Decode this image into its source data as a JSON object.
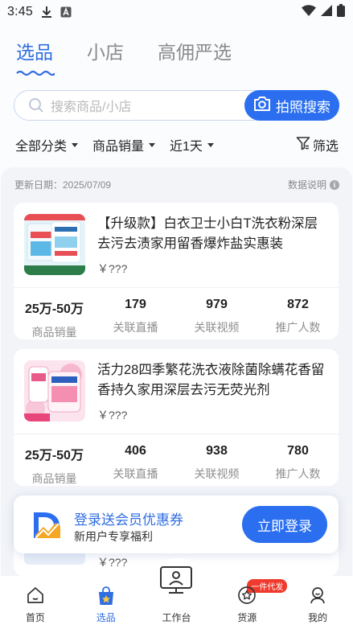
{
  "status_bar": {
    "time": "3:45"
  },
  "tabs": [
    {
      "label": "选品",
      "active": true
    },
    {
      "label": "小店",
      "active": false
    },
    {
      "label": "高佣严选",
      "active": false
    }
  ],
  "search": {
    "placeholder": "搜索商品/小店",
    "photo_button": "拍照搜索"
  },
  "filters": {
    "category": "全部分类",
    "sort": "商品销量",
    "range": "近1天",
    "screen": "筛选"
  },
  "meta": {
    "updated": "更新日期：2025/07/09",
    "explain": "数据说明"
  },
  "products": [
    {
      "title": "【升级款】白衣卫士小白T洗衣粉深层去污去渍家用留香爆炸盐实惠装",
      "price": "￥???",
      "stats": [
        {
          "value": "25万-50万",
          "label": "商品销量"
        },
        {
          "value": "179",
          "label": "关联直播"
        },
        {
          "value": "979",
          "label": "关联视频"
        },
        {
          "value": "872",
          "label": "推广人数"
        }
      ]
    },
    {
      "title": "活力28四季繁花洗衣液除菌除螨花香留香持久家用深层去污无荧光剂",
      "price": "￥???",
      "stats": [
        {
          "value": "25万-50万",
          "label": "商品销量"
        },
        {
          "value": "406",
          "label": "关联直播"
        },
        {
          "value": "938",
          "label": "关联视频"
        },
        {
          "value": "780",
          "label": "推广人数"
        }
      ]
    }
  ],
  "peek": {
    "price": "￥???"
  },
  "banner": {
    "title": "登录送会员优惠券",
    "subtitle": "新用户专享福利",
    "button": "立即登录"
  },
  "bottom_nav": [
    {
      "label": "首页",
      "icon": "home-icon",
      "active": false
    },
    {
      "label": "选品",
      "icon": "shopping-bag-icon",
      "active": true
    },
    {
      "label": "工作台",
      "icon": "workbench-icon",
      "active": false
    },
    {
      "label": "货源",
      "icon": "supply-icon",
      "active": false,
      "badge": "一件代发"
    },
    {
      "label": "我的",
      "icon": "profile-icon",
      "active": false
    }
  ],
  "colors": {
    "accent": "#2b6ff0",
    "badge": "#ef3a2d"
  }
}
